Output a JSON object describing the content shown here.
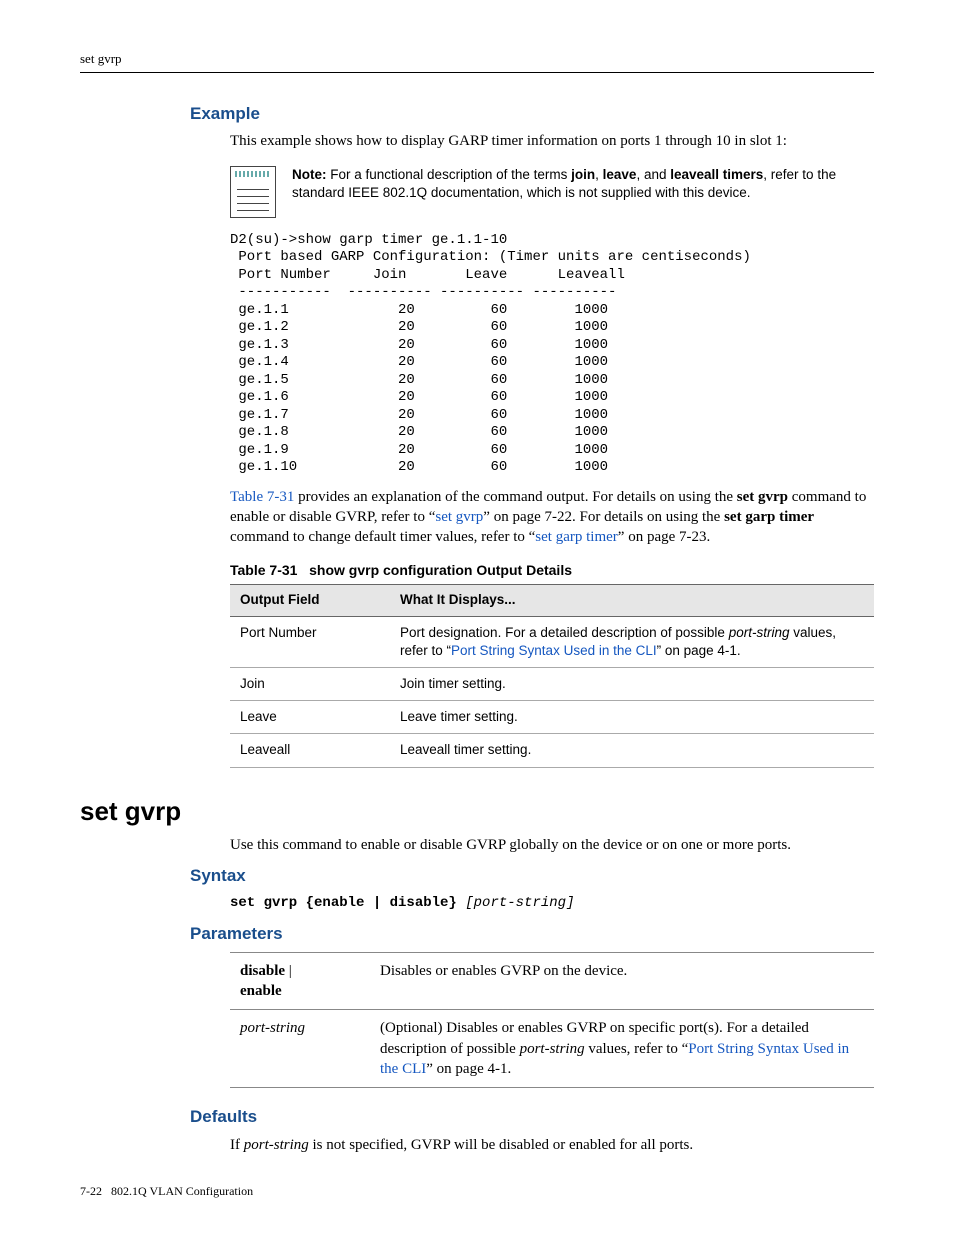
{
  "header": {
    "running": "set gvrp"
  },
  "example": {
    "heading": "Example",
    "intro": "This example shows how to display GARP timer information on ports 1 through 10 in slot 1:",
    "note_label": "Note:",
    "note_body": " For a functional description of the terms ",
    "note_t1": "join",
    "note_c1": ", ",
    "note_t2": "leave",
    "note_c2": ", and ",
    "note_t3": "leaveall timers",
    "note_tail": ", refer to the standard IEEE 802.1Q documentation, which is not supplied with this device.",
    "cli": "D2(su)->show garp timer ge.1.1-10\n Port based GARP Configuration: (Timer units are centiseconds)\n Port Number     Join       Leave      Leaveall\n -----------  ---------- ---------- ----------\n ge.1.1             20         60        1000\n ge.1.2             20         60        1000\n ge.1.3             20         60        1000\n ge.1.4             20         60        1000\n ge.1.5             20         60        1000\n ge.1.6             20         60        1000\n ge.1.7             20         60        1000\n ge.1.8             20         60        1000\n ge.1.9             20         60        1000\n ge.1.10            20         60        1000",
    "post_link1": "Table 7-31",
    "post_a": " provides an explanation of the command output. For details on using the ",
    "post_b": "set gvrp",
    "post_c": " command to enable or disable GVRP, refer to “",
    "post_link2": "set gvrp",
    "post_d": "” on page 7-22. For details on using the ",
    "post_e": "set garp timer",
    "post_f": " command to change default timer values, refer to “",
    "post_link3": "set garp timer",
    "post_g": "” on page 7-23."
  },
  "table731": {
    "caption_no": "Table 7-31",
    "caption_title": "show gvrp configuration Output Details",
    "h1": "Output Field",
    "h2": "What It Displays...",
    "rows": [
      {
        "field": "Port Number",
        "desc_a": "Port designation. For a detailed description of possible ",
        "desc_i": "port-string",
        "desc_b": " values, refer to “",
        "desc_link": "Port String Syntax Used in the CLI",
        "desc_c": "” on page 4-1."
      },
      {
        "field": "Join",
        "desc_a": "Join timer setting."
      },
      {
        "field": "Leave",
        "desc_a": "Leave timer setting."
      },
      {
        "field": "Leaveall",
        "desc_a": "Leaveall timer setting."
      }
    ]
  },
  "chart_data": {
    "type": "table",
    "title": "Port based GARP Configuration (Timer units are centiseconds)",
    "columns": [
      "Port Number",
      "Join",
      "Leave",
      "Leaveall"
    ],
    "rows": [
      [
        "ge.1.1",
        20,
        60,
        1000
      ],
      [
        "ge.1.2",
        20,
        60,
        1000
      ],
      [
        "ge.1.3",
        20,
        60,
        1000
      ],
      [
        "ge.1.4",
        20,
        60,
        1000
      ],
      [
        "ge.1.5",
        20,
        60,
        1000
      ],
      [
        "ge.1.6",
        20,
        60,
        1000
      ],
      [
        "ge.1.7",
        20,
        60,
        1000
      ],
      [
        "ge.1.8",
        20,
        60,
        1000
      ],
      [
        "ge.1.9",
        20,
        60,
        1000
      ],
      [
        "ge.1.10",
        20,
        60,
        1000
      ]
    ]
  },
  "setgvrp": {
    "title": "set gvrp",
    "intro": "Use this command to enable or disable GVRP globally on the device or on one or more ports.",
    "syntax_h": "Syntax",
    "syntax_bold": "set gvrp {enable | disable} ",
    "syntax_opt": "[port-string]",
    "params_h": "Parameters",
    "params": [
      {
        "name_a": "disable",
        "name_sep": " | ",
        "name_b": "enable",
        "desc_a": "Disables or enables GVRP on the device."
      },
      {
        "name_i": "port-string",
        "desc_a": "(Optional) Disables or enables GVRP on specific port(s). For a detailed description of possible ",
        "desc_i": "port-string",
        "desc_b": " values, refer to “",
        "desc_link": "Port String Syntax Used in the CLI",
        "desc_c": "” on page 4-1."
      }
    ],
    "defaults_h": "Defaults",
    "defaults_a": "If ",
    "defaults_i": "port-string",
    "defaults_b": " is not specified, GVRP will be disabled or enabled for all ports."
  },
  "footer": {
    "page": "7-22",
    "title": "802.1Q VLAN Configuration"
  }
}
